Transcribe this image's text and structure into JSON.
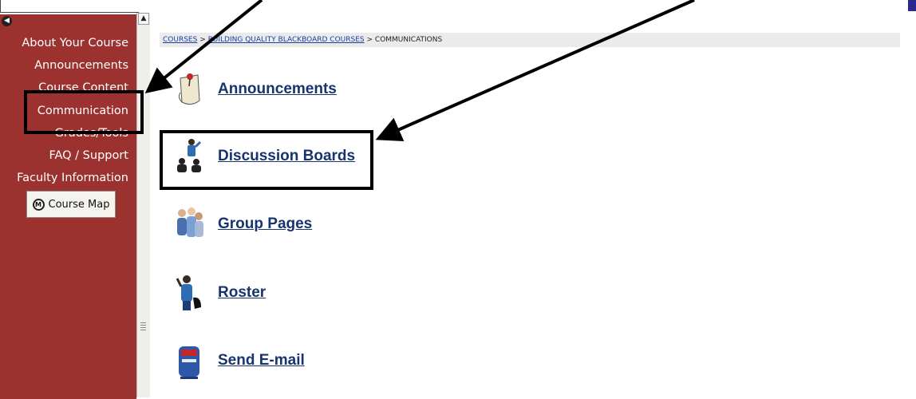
{
  "sidebar": {
    "items": [
      {
        "label": "About Your Course"
      },
      {
        "label": "Announcements"
      },
      {
        "label": "Course Content"
      },
      {
        "label": "Communication"
      },
      {
        "label": "Grades/Tools"
      },
      {
        "label": "FAQ / Support"
      },
      {
        "label": "Faculty Information"
      }
    ],
    "course_map_label": "Course Map"
  },
  "breadcrumb": {
    "courses": "COURSES",
    "sep1": ">",
    "course": "BUILDING QUALITY BLACKBOARD COURSES",
    "sep2": ">",
    "current": "COMMUNICATIONS"
  },
  "tools": [
    {
      "label": "Announcements",
      "icon": "push-pin-paper-icon"
    },
    {
      "label": "Discussion Boards",
      "icon": "speaking-people-icon"
    },
    {
      "label": "Group Pages",
      "icon": "group-people-icon"
    },
    {
      "label": "Roster",
      "icon": "person-waving-icon"
    },
    {
      "label": "Send E-mail",
      "icon": "mailbox-icon"
    }
  ],
  "colors": {
    "sidebar": "#9b3230",
    "link": "#17346e",
    "annotation": "#000000"
  }
}
